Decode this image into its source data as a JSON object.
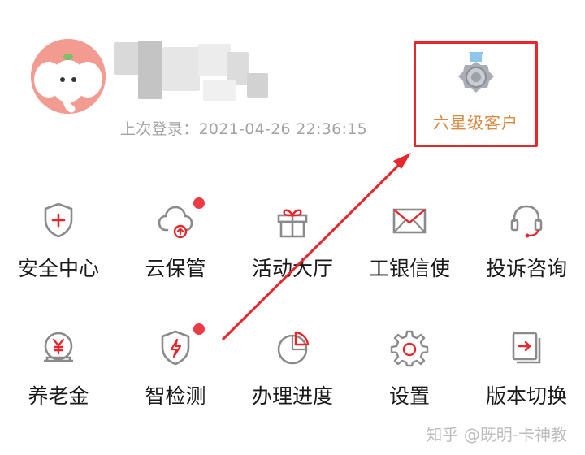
{
  "profile": {
    "last_login": "上次登录：2021-04-26 22:36:15"
  },
  "tier": {
    "label": "六星级客户",
    "icon": "medal-icon",
    "highlight_color": "#e8262c",
    "label_color": "#d98a42"
  },
  "grid": {
    "items": [
      {
        "label": "安全中心",
        "icon": "shield-plus-icon"
      },
      {
        "label": "云保管",
        "icon": "cloud-upload-icon"
      },
      {
        "label": "活动大厅",
        "icon": "gift-icon"
      },
      {
        "label": "工银信使",
        "icon": "envelope-icon"
      },
      {
        "label": "投诉咨询",
        "icon": "headset-icon"
      },
      {
        "label": "养老金",
        "icon": "yen-jar-icon"
      },
      {
        "label": "智检测",
        "icon": "shield-bolt-icon"
      },
      {
        "label": "办理进度",
        "icon": "pie-progress-icon"
      },
      {
        "label": "设置",
        "icon": "gear-icon"
      },
      {
        "label": "版本切换",
        "icon": "switch-version-icon"
      }
    ],
    "icon_color": "#8a8a8a",
    "accent_color": "#e8262c",
    "badge_color": "#ee3a45"
  },
  "watermark": "知乎 @既明-卡神教"
}
